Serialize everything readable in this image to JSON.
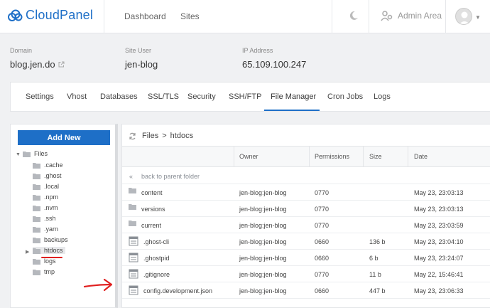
{
  "app": {
    "brand": "CloudPanel",
    "nav": [
      "Dashboard",
      "Sites"
    ],
    "admin_label": "Admin Area"
  },
  "site": {
    "domain_label": "Domain",
    "domain": "blog.jen.do",
    "user_label": "Site User",
    "user": "jen-blog",
    "ip_label": "IP Address",
    "ip": "65.109.100.247"
  },
  "tabs": [
    "Settings",
    "Vhost",
    "Databases",
    "SSL/TLS",
    "Security",
    "SSH/FTP",
    "File Manager",
    "Cron Jobs",
    "Logs"
  ],
  "active_tab": "File Manager",
  "tree": {
    "add_new": "Add New",
    "root": "Files",
    "items": [
      ".cache",
      ".ghost",
      ".local",
      ".npm",
      ".nvm",
      ".ssh",
      ".yarn",
      "backups",
      "htdocs",
      "logs",
      "tmp"
    ]
  },
  "files": {
    "breadcrumb": [
      "Files",
      "htdocs"
    ],
    "headers": [
      "Owner",
      "Permissions",
      "Size",
      "Date"
    ],
    "parent_link": "back to parent folder",
    "rows": [
      {
        "name": "content",
        "type": "folder",
        "owner": "jen-blog:jen-blog",
        "perm": "0770",
        "size": "",
        "date": "May 23, 23:03:13"
      },
      {
        "name": "versions",
        "type": "folder",
        "owner": "jen-blog:jen-blog",
        "perm": "0770",
        "size": "",
        "date": "May 23, 23:03:13"
      },
      {
        "name": "current",
        "type": "folder",
        "owner": "jen-blog:jen-blog",
        "perm": "0770",
        "size": "",
        "date": "May 23, 23:03:59"
      },
      {
        "name": ".ghost-cli",
        "type": "file",
        "owner": "jen-blog:jen-blog",
        "perm": "0660",
        "size": "136 b",
        "date": "May 23, 23:04:10"
      },
      {
        "name": ".ghostpid",
        "type": "file",
        "owner": "jen-blog:jen-blog",
        "perm": "0660",
        "size": "6 b",
        "date": "May 23, 23:24:07"
      },
      {
        "name": ".gitignore",
        "type": "file",
        "owner": "jen-blog:jen-blog",
        "perm": "0770",
        "size": "11 b",
        "date": "May 22, 15:46:41"
      },
      {
        "name": "config.development.json",
        "type": "file",
        "owner": "jen-blog:jen-blog",
        "perm": "0660",
        "size": "447 b",
        "date": "May 23, 23:06:33"
      }
    ]
  },
  "colors": {
    "accent": "#1e6fc7",
    "annotation": "#e02020"
  }
}
